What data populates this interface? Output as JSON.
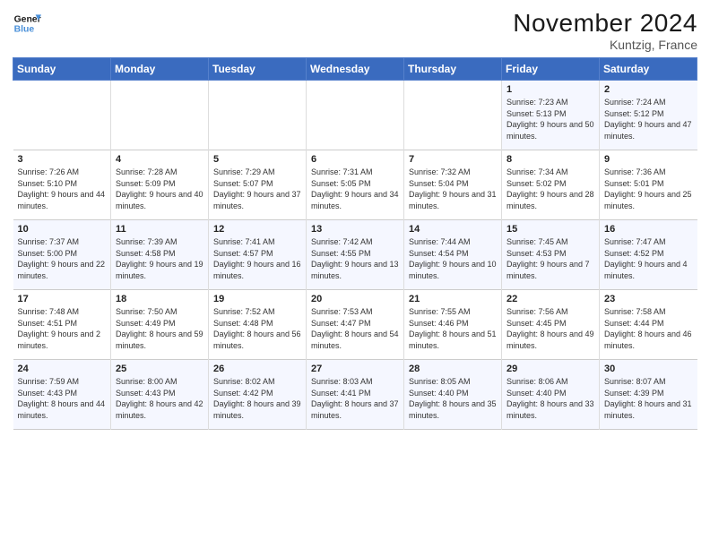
{
  "logo": {
    "line1": "General",
    "line2": "Blue"
  },
  "title": "November 2024",
  "location": "Kuntzig, France",
  "days_of_week": [
    "Sunday",
    "Monday",
    "Tuesday",
    "Wednesday",
    "Thursday",
    "Friday",
    "Saturday"
  ],
  "weeks": [
    [
      {
        "day": "",
        "info": ""
      },
      {
        "day": "",
        "info": ""
      },
      {
        "day": "",
        "info": ""
      },
      {
        "day": "",
        "info": ""
      },
      {
        "day": "",
        "info": ""
      },
      {
        "day": "1",
        "info": "Sunrise: 7:23 AM\nSunset: 5:13 PM\nDaylight: 9 hours and 50 minutes."
      },
      {
        "day": "2",
        "info": "Sunrise: 7:24 AM\nSunset: 5:12 PM\nDaylight: 9 hours and 47 minutes."
      }
    ],
    [
      {
        "day": "3",
        "info": "Sunrise: 7:26 AM\nSunset: 5:10 PM\nDaylight: 9 hours and 44 minutes."
      },
      {
        "day": "4",
        "info": "Sunrise: 7:28 AM\nSunset: 5:09 PM\nDaylight: 9 hours and 40 minutes."
      },
      {
        "day": "5",
        "info": "Sunrise: 7:29 AM\nSunset: 5:07 PM\nDaylight: 9 hours and 37 minutes."
      },
      {
        "day": "6",
        "info": "Sunrise: 7:31 AM\nSunset: 5:05 PM\nDaylight: 9 hours and 34 minutes."
      },
      {
        "day": "7",
        "info": "Sunrise: 7:32 AM\nSunset: 5:04 PM\nDaylight: 9 hours and 31 minutes."
      },
      {
        "day": "8",
        "info": "Sunrise: 7:34 AM\nSunset: 5:02 PM\nDaylight: 9 hours and 28 minutes."
      },
      {
        "day": "9",
        "info": "Sunrise: 7:36 AM\nSunset: 5:01 PM\nDaylight: 9 hours and 25 minutes."
      }
    ],
    [
      {
        "day": "10",
        "info": "Sunrise: 7:37 AM\nSunset: 5:00 PM\nDaylight: 9 hours and 22 minutes."
      },
      {
        "day": "11",
        "info": "Sunrise: 7:39 AM\nSunset: 4:58 PM\nDaylight: 9 hours and 19 minutes."
      },
      {
        "day": "12",
        "info": "Sunrise: 7:41 AM\nSunset: 4:57 PM\nDaylight: 9 hours and 16 minutes."
      },
      {
        "day": "13",
        "info": "Sunrise: 7:42 AM\nSunset: 4:55 PM\nDaylight: 9 hours and 13 minutes."
      },
      {
        "day": "14",
        "info": "Sunrise: 7:44 AM\nSunset: 4:54 PM\nDaylight: 9 hours and 10 minutes."
      },
      {
        "day": "15",
        "info": "Sunrise: 7:45 AM\nSunset: 4:53 PM\nDaylight: 9 hours and 7 minutes."
      },
      {
        "day": "16",
        "info": "Sunrise: 7:47 AM\nSunset: 4:52 PM\nDaylight: 9 hours and 4 minutes."
      }
    ],
    [
      {
        "day": "17",
        "info": "Sunrise: 7:48 AM\nSunset: 4:51 PM\nDaylight: 9 hours and 2 minutes."
      },
      {
        "day": "18",
        "info": "Sunrise: 7:50 AM\nSunset: 4:49 PM\nDaylight: 8 hours and 59 minutes."
      },
      {
        "day": "19",
        "info": "Sunrise: 7:52 AM\nSunset: 4:48 PM\nDaylight: 8 hours and 56 minutes."
      },
      {
        "day": "20",
        "info": "Sunrise: 7:53 AM\nSunset: 4:47 PM\nDaylight: 8 hours and 54 minutes."
      },
      {
        "day": "21",
        "info": "Sunrise: 7:55 AM\nSunset: 4:46 PM\nDaylight: 8 hours and 51 minutes."
      },
      {
        "day": "22",
        "info": "Sunrise: 7:56 AM\nSunset: 4:45 PM\nDaylight: 8 hours and 49 minutes."
      },
      {
        "day": "23",
        "info": "Sunrise: 7:58 AM\nSunset: 4:44 PM\nDaylight: 8 hours and 46 minutes."
      }
    ],
    [
      {
        "day": "24",
        "info": "Sunrise: 7:59 AM\nSunset: 4:43 PM\nDaylight: 8 hours and 44 minutes."
      },
      {
        "day": "25",
        "info": "Sunrise: 8:00 AM\nSunset: 4:43 PM\nDaylight: 8 hours and 42 minutes."
      },
      {
        "day": "26",
        "info": "Sunrise: 8:02 AM\nSunset: 4:42 PM\nDaylight: 8 hours and 39 minutes."
      },
      {
        "day": "27",
        "info": "Sunrise: 8:03 AM\nSunset: 4:41 PM\nDaylight: 8 hours and 37 minutes."
      },
      {
        "day": "28",
        "info": "Sunrise: 8:05 AM\nSunset: 4:40 PM\nDaylight: 8 hours and 35 minutes."
      },
      {
        "day": "29",
        "info": "Sunrise: 8:06 AM\nSunset: 4:40 PM\nDaylight: 8 hours and 33 minutes."
      },
      {
        "day": "30",
        "info": "Sunrise: 8:07 AM\nSunset: 4:39 PM\nDaylight: 8 hours and 31 minutes."
      }
    ]
  ]
}
